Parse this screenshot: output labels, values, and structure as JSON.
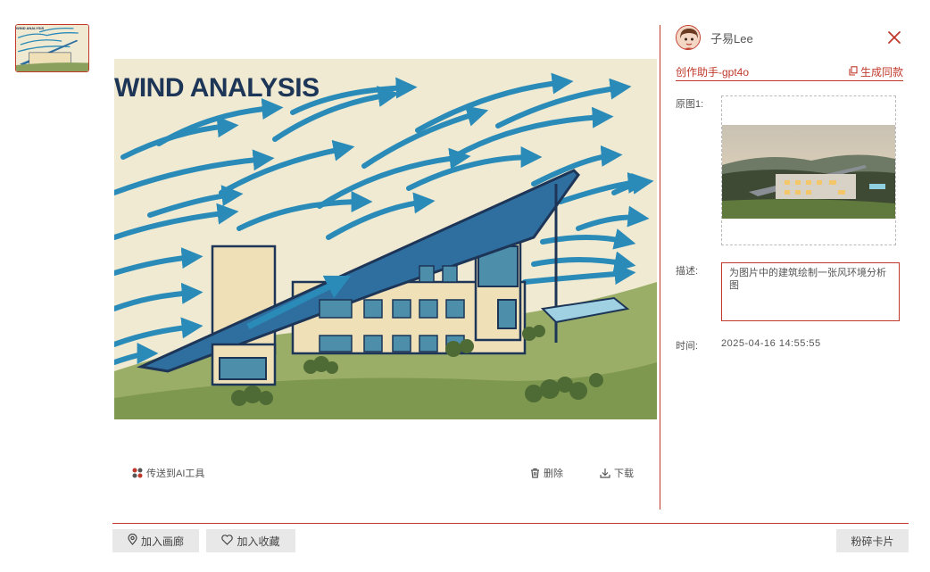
{
  "thumbnail": {
    "title_text": "WIND ANALYSIS"
  },
  "main_image": {
    "title_text": "WIND ANALYSIS"
  },
  "actions": {
    "send_to_ai": "传送到AI工具",
    "delete": "删除",
    "download": "下载"
  },
  "panel": {
    "username": "子易Lee",
    "assistant_tab": "创作助手-gpt4o",
    "generate_same": "生成同款",
    "original_label": "原图1:",
    "description_label": "描述:",
    "description_text": "为图片中的建筑绘制一张风环境分析图",
    "time_label": "时间:",
    "time_value": "2025-04-16 14:55:55"
  },
  "footer": {
    "add_gallery": "加入画廊",
    "add_favorite": "加入收藏",
    "shred_card": "粉碎卡片"
  },
  "colors": {
    "accent": "#c0392b",
    "wind_blue": "#2a8bb8",
    "paper": "#f1ead2"
  },
  "icons": [
    "ai-tools-icon",
    "trash-icon",
    "download-icon",
    "close-icon",
    "copy-icon",
    "location-pin-icon",
    "heart-icon"
  ]
}
